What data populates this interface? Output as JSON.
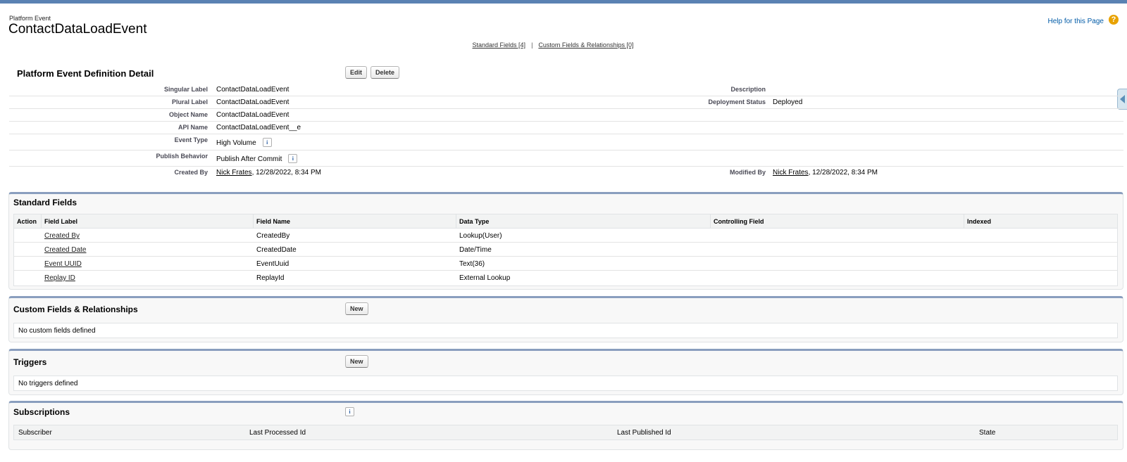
{
  "page": {
    "type": "Platform Event",
    "title": "ContactDataLoadEvent",
    "help": "Help for this Page",
    "help_icon": "question-circle-icon"
  },
  "quicklinks": {
    "standard": "Standard Fields [4]",
    "separator": "|",
    "custom": "Custom Fields & Relationships [0]"
  },
  "detail": {
    "title": "Platform Event Definition Detail",
    "edit": "Edit",
    "delete": "Delete",
    "rows": [
      {
        "label": "Singular Label",
        "value": "ContactDataLoadEvent",
        "label2": "Description",
        "value2": ""
      },
      {
        "label": "Plural Label",
        "value": "ContactDataLoadEvent",
        "label2": "Deployment Status",
        "value2": "Deployed"
      },
      {
        "label": "Object Name",
        "value": "ContactDataLoadEvent"
      },
      {
        "label": "API Name",
        "value": "ContactDataLoadEvent__e"
      },
      {
        "label": "Event Type",
        "value": "High Volume"
      },
      {
        "label": "Publish Behavior",
        "value": "Publish After Commit"
      }
    ],
    "created_by": {
      "label": "Created By",
      "user": "Nick Frates",
      "date": ", 12/28/2022, 8:34 PM"
    },
    "modified_by": {
      "label": "Modified By",
      "user": "Nick Frates",
      "date": ", 12/28/2022, 8:34 PM"
    },
    "info_icon": "i"
  },
  "standard_fields": {
    "title": "Standard Fields",
    "columns": [
      "Action",
      "Field Label",
      "Field Name",
      "Data Type",
      "Controlling Field",
      "Indexed"
    ],
    "rows": [
      {
        "label": "Created By",
        "name": "CreatedBy",
        "type": "Lookup(User)"
      },
      {
        "label": "Created Date",
        "name": "CreatedDate",
        "type": "Date/Time"
      },
      {
        "label": "Event UUID",
        "name": "EventUuid",
        "type": "Text(36)"
      },
      {
        "label": "Replay ID",
        "name": "ReplayId",
        "type": "External Lookup"
      }
    ]
  },
  "custom_fields": {
    "title": "Custom Fields & Relationships",
    "new": "New",
    "empty": "No custom fields defined"
  },
  "triggers": {
    "title": "Triggers",
    "new": "New",
    "empty": "No triggers defined"
  },
  "subscriptions": {
    "title": "Subscriptions",
    "info": "i",
    "columns": [
      "Subscriber",
      "Last Processed Id",
      "Last Published Id",
      "State"
    ]
  },
  "colors": {
    "top_strip": "#5a82b3",
    "section_border": "#8a9ebe",
    "help_icon": "#e8a200"
  }
}
